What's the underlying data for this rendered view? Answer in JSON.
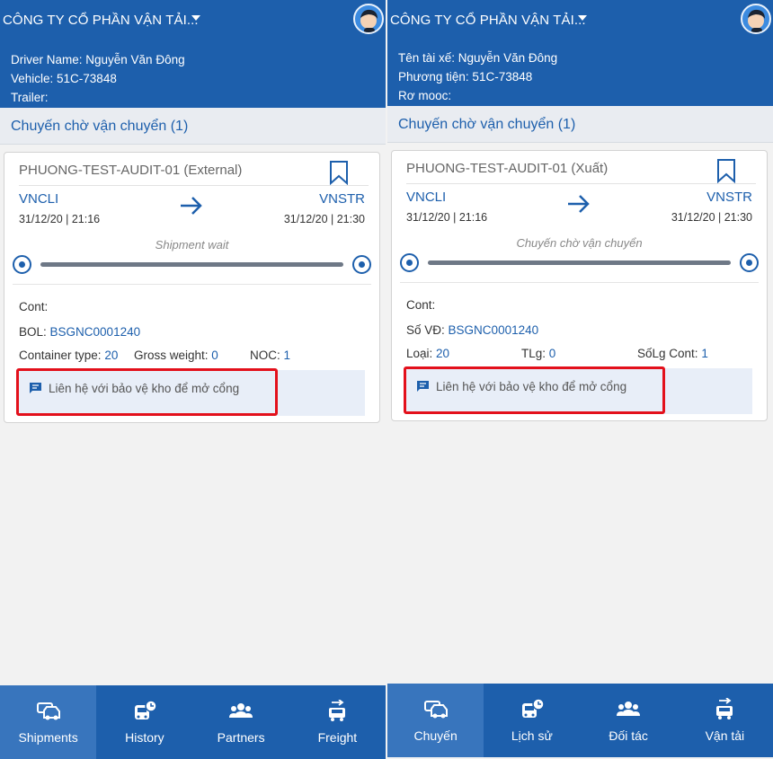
{
  "screens": [
    {
      "company": "CÔNG TY CỔ PHẦN VẬN TẢI...",
      "driver_line": "Driver Name: Nguyễn Văn Đông",
      "vehicle_line": "Vehicle: 51C-73848",
      "trailer_line": "Trailer:",
      "section_title": "Chuyến chờ vận chuyển (1)",
      "card": {
        "id": "PHUONG-TEST-AUDIT-01 (External)",
        "from": "VNCLI",
        "from_time": "31/12/20 | 21:16",
        "to": "VNSTR",
        "to_time": "31/12/20 | 21:30",
        "status": "Shipment wait",
        "cont_label": "Cont:",
        "bol_label": "BOL:",
        "bol_value": "BSGNC0001240",
        "spec1_label": "Container type:",
        "spec1_value": "20",
        "spec2_label": "Gross weight:",
        "spec2_value": "0",
        "spec3_label": "NOC:",
        "spec3_value": "1",
        "note": "Liên hệ với bảo vệ kho để mở cổng"
      },
      "nav": [
        "Shipments",
        "History",
        "Partners",
        "Freight"
      ]
    },
    {
      "company": "CÔNG TY CỔ PHẦN VẬN TẢI...",
      "driver_line": "Tên tài xế: Nguyễn Văn Đông",
      "vehicle_line": "Phương tiện: 51C-73848",
      "trailer_line": "Rơ mooc:",
      "section_title": "Chuyến chờ vận chuyển (1)",
      "card": {
        "id": "PHUONG-TEST-AUDIT-01 (Xuất)",
        "from": "VNCLI",
        "from_time": "31/12/20 | 21:16",
        "to": "VNSTR",
        "to_time": "31/12/20 | 21:30",
        "status": "Chuyến chờ vận chuyển",
        "cont_label": "Cont:",
        "bol_label": "Số VĐ:",
        "bol_value": "BSGNC0001240",
        "spec1_label": "Loại:",
        "spec1_value": "20",
        "spec2_label": "TLg:",
        "spec2_value": "0",
        "spec3_label": "SốLg Cont:",
        "spec3_value": "1",
        "note": "Liên hệ với bảo vệ kho để mở cổng"
      },
      "nav": [
        "Chuyến",
        "Lịch sử",
        "Đối tác",
        "Vận tải"
      ]
    }
  ],
  "colors": {
    "primary": "#1d5fac",
    "active_tab": "#3875bd",
    "highlight": "#e3101b",
    "note_bg": "#e8eef8"
  },
  "icons": {
    "nav": [
      "car-icon",
      "bus-clock-icon",
      "people-icon",
      "truck-icon"
    ]
  }
}
